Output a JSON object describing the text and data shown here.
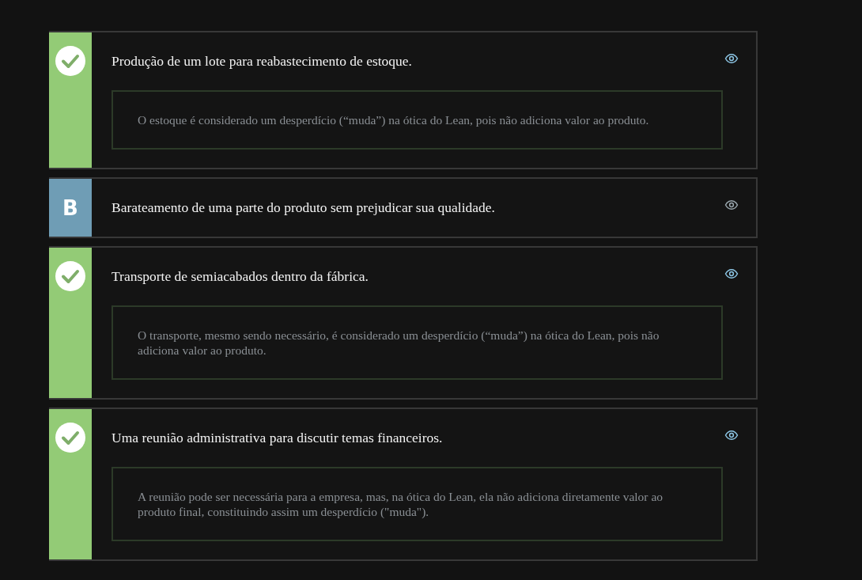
{
  "options": [
    {
      "kind": "correct",
      "text": "Produção de um lote para reabastecimento de estoque.",
      "explanation": "O estoque é considerado um desperdício (“muda”) na ótica do Lean, pois não adiciona valor ao produto."
    },
    {
      "kind": "letter",
      "letter": "B",
      "text": "Barateamento de uma parte do produto sem prejudicar sua qualidade."
    },
    {
      "kind": "correct",
      "text": "Transporte de semiacabados dentro da fábrica.",
      "explanation": "O transporte, mesmo sendo necessário, é considerado um desperdício (“muda”) na ótica do Lean, pois não adiciona valor ao produto."
    },
    {
      "kind": "correct",
      "text": "Uma reunião administrativa para discutir temas financeiros.",
      "explanation": "A reunião pode ser necessária para a empresa, mas, na ótica do Lean, ela não adiciona diretamente valor ao produto final, constituindo assim um desperdício (\"muda\")."
    }
  ]
}
